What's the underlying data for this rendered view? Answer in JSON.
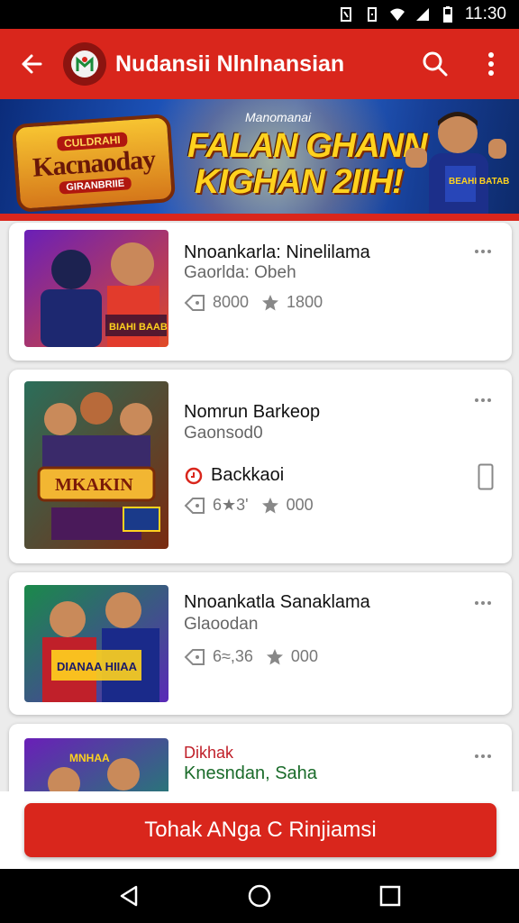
{
  "status_bar": {
    "time": "11:30"
  },
  "app_bar": {
    "title": "Nudansii Nlnlnansian"
  },
  "banner": {
    "logo_top": "CULDRAHI",
    "logo_main": "Kacnaoday",
    "logo_sub": "GIRANBRIIE",
    "small_text": "Manomanai",
    "headline_line1": "FALAN GHANN",
    "headline_line2": "KIGHAN 2IIH!",
    "player_badge": "BEAHI BATAB"
  },
  "items": [
    {
      "title": "Nnoankarla: Ninelilama",
      "subtitle": "Gaorlda: Obeh",
      "stat1": "8000",
      "stat2": "1800",
      "thumb_caption": "BIAHI BAAB"
    },
    {
      "title": "Nomrun Barkeop",
      "subtitle": "Gaonsod0",
      "link": "Backkaoi",
      "stat1": "6★3'",
      "stat2": "000",
      "thumb_caption": "MKAKIN"
    },
    {
      "title": "Nnoankatla Sanaklama",
      "subtitle": "Glaoodan",
      "stat1": "6≈,36",
      "stat2": "000",
      "thumb_caption": "DIANAA HIIAA"
    },
    {
      "title": "Dikhak",
      "subtitle": "Knesndan, Saha",
      "thumb_caption": "MNHAA"
    }
  ],
  "cta": {
    "label": "Tohak ANga C Rinjiamsi"
  },
  "colors": {
    "accent": "#d9261c",
    "title_red": "#c0202a",
    "subtitle_green": "#1a6b2a"
  }
}
